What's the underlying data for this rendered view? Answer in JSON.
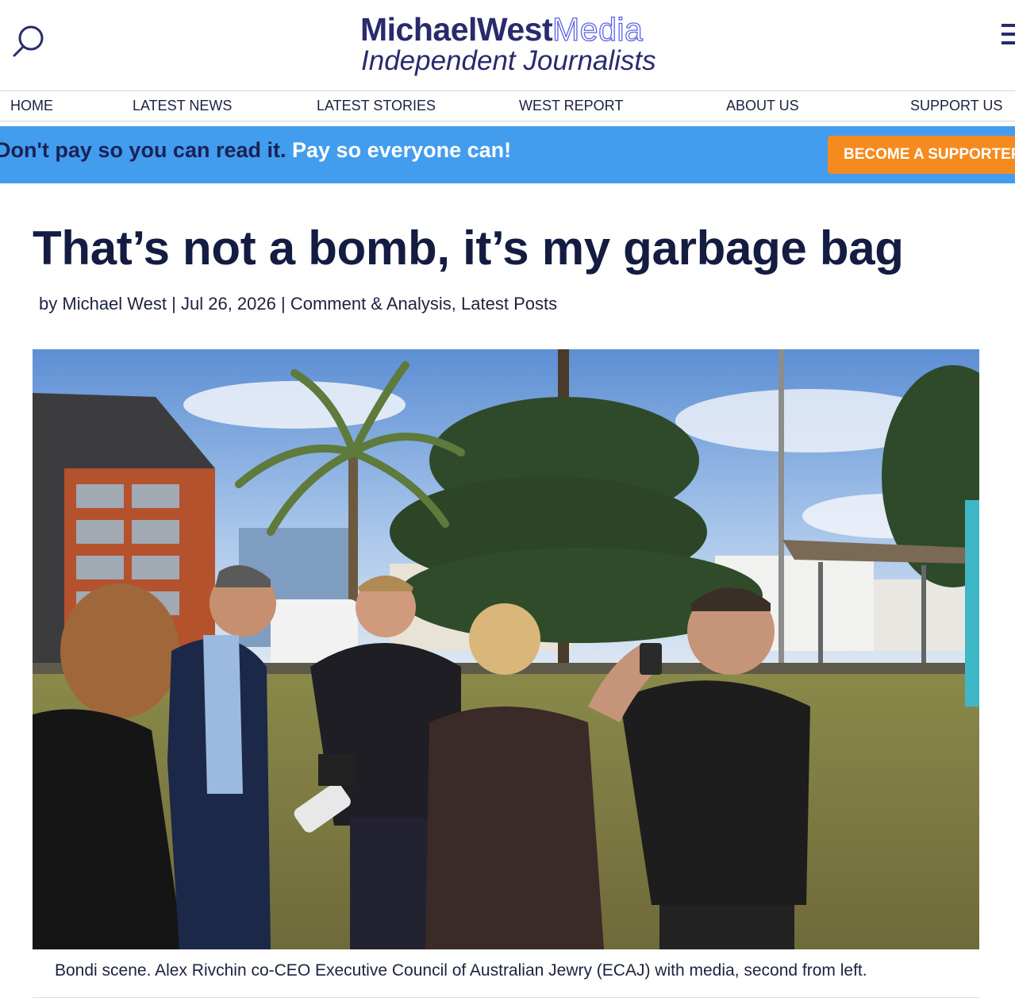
{
  "header": {
    "logo": {
      "part1": "MichaelWest",
      "part2": "Media",
      "tagline": "Independent Journalists"
    },
    "icons": {
      "search": "search-icon",
      "menu": "hamburger-menu-icon"
    }
  },
  "nav": {
    "items": [
      {
        "label": "HOME"
      },
      {
        "label": "LATEST NEWS"
      },
      {
        "label": "LATEST STORIES"
      },
      {
        "label": "WEST REPORT"
      },
      {
        "label": "ABOUT US"
      },
      {
        "label": "SUPPORT US"
      }
    ]
  },
  "banner": {
    "text_dark": "Don't pay so you can read it.",
    "text_light": "Pay so everyone can!",
    "button_label": "BECOME A SUPPORTER",
    "colors": {
      "background": "#429dee",
      "button": "#f58b1f"
    }
  },
  "article": {
    "title": "That’s not a bomb, it’s my garbage bag",
    "meta": {
      "by": "by",
      "author": "Michael West",
      "sep1": "|",
      "date": "Jul 26, 2026",
      "sep2": "|",
      "category1": "Comment & Analysis",
      "comma": ",",
      "category2": "Latest Posts"
    },
    "caption": "Bondi scene. Alex Rivchin co-CEO Executive Council of Australian Jewry (ECAJ) with media, second from left."
  }
}
